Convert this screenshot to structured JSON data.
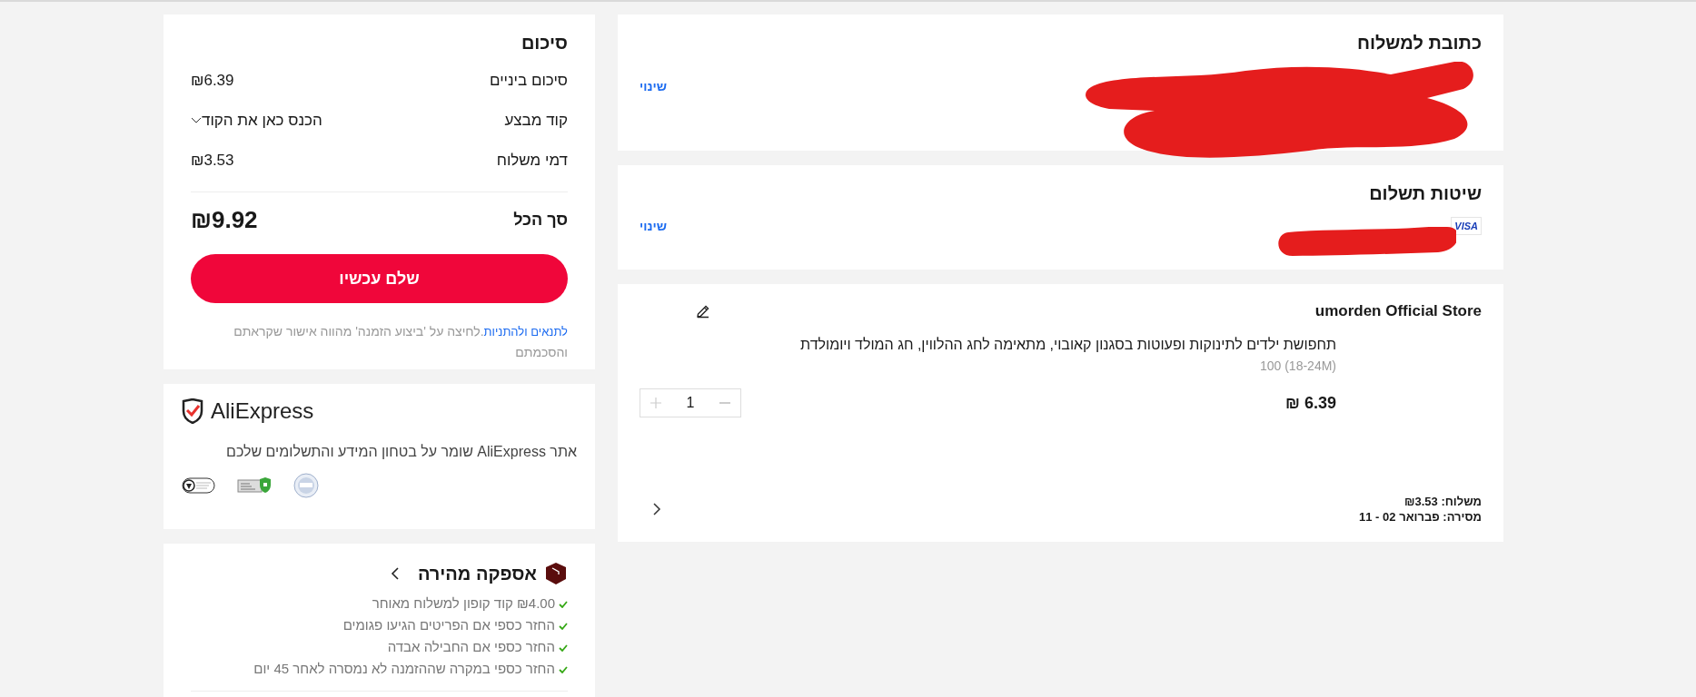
{
  "shipping_address": {
    "title": "כתובת למשלוח",
    "change_link": "שינוי"
  },
  "payment_methods": {
    "title": "שיטות תשלום",
    "card_brand": "VISA",
    "change_link": "שינוי"
  },
  "store": {
    "name": "umorden Official Store",
    "item": {
      "title": "תחפושת ילדים לתינוקות ופעוטות בסגנון קאובוי, מתאימה לחג ההלווין, חג המולד ויומולדת",
      "variant": "100 (18-24M)",
      "price": "₪ 6.39",
      "quantity": "1"
    },
    "shipping_label": "משלוח:",
    "shipping_value": "₪3.53",
    "delivery_label": "מסירה:",
    "delivery_value": "פברואר 02 - 11"
  },
  "summary": {
    "title": "סיכום",
    "rows": [
      {
        "kind": "amount",
        "label": "סיכום ביניים",
        "value": "₪6.39"
      },
      {
        "kind": "coupon",
        "label": "קוד מבצע",
        "value": "הכנס כאן את הקוד"
      },
      {
        "kind": "amount",
        "label": "דמי משלוח",
        "value": "₪3.53"
      }
    ],
    "total_label": "סך הכל",
    "total_value": "₪9.92",
    "pay_button": "שלם עכשיו",
    "terms_link": "לתנאים ולהתניות",
    "terms_text": ".לחיצה על 'ביצוע הזמנה' מהווה אישור שקראתם והסכמתם"
  },
  "security": {
    "logo_text": "AliExpress",
    "text": "אתר AliExpress שומר על בטחון המידע והתשלומים שלכם"
  },
  "fast_delivery": {
    "title": "אספקה מהירה",
    "items": [
      "₪4.00 קוד קופון למשלוח מאוחר",
      "החזר כספי אם הפריטים הגיעו פגומים",
      "החזר כספי אם החבילה אבדה",
      "החזר כספי במקרה שההזמנה לא נמסרה לאחר 45 יום"
    ]
  }
}
